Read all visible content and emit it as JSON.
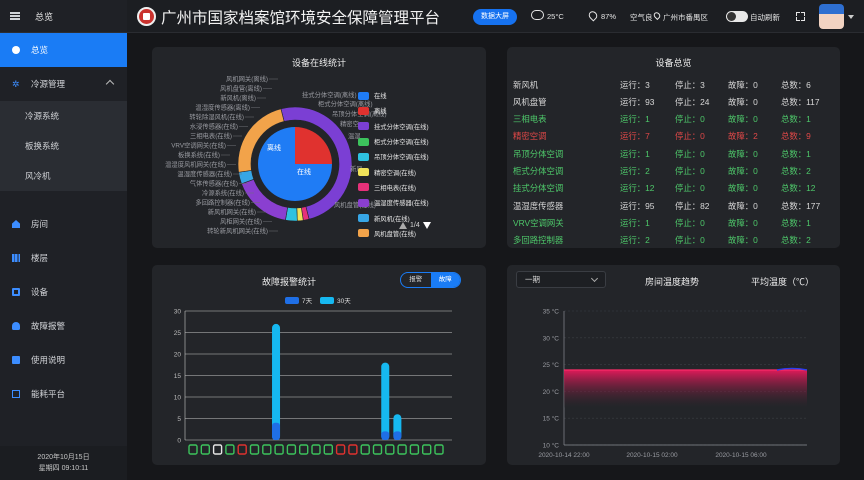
{
  "sidebar": {
    "header": "总览",
    "items": [
      {
        "label": "总览",
        "icon": "home-circle-icon"
      },
      {
        "label": "冷源管理",
        "icon": "snowflake-icon"
      },
      {
        "label": "房间",
        "icon": "house-icon"
      },
      {
        "label": "楼层",
        "icon": "building-icon"
      },
      {
        "label": "设备",
        "icon": "monitor-icon"
      },
      {
        "label": "故障报警",
        "icon": "bell-icon"
      },
      {
        "label": "使用说明",
        "icon": "doc-icon"
      },
      {
        "label": "能耗平台",
        "icon": "external-link-icon"
      }
    ],
    "subitems": [
      "冷源系统",
      "板换系统",
      "风冷机"
    ],
    "date": "2020年10月15日",
    "time": "星期四 09:10:11"
  },
  "topbar": {
    "title": "广州市国家档案馆环境安全保障管理平台",
    "big_screen": "数据大屏",
    "temperature": "25°C",
    "humidity": "87%",
    "air": "空气良",
    "location": "广州市番禺区",
    "auto_refresh": "自动刷新"
  },
  "online_panel": {
    "title": "设备在线统计",
    "legend": [
      {
        "label": "在线",
        "color": "#1f7cf5"
      },
      {
        "label": "离线",
        "color": "#e0322f"
      },
      {
        "label": "挂式分体空调(在线)",
        "color": "#7b3fd4"
      },
      {
        "label": "柜式分体空调(在线)",
        "color": "#3cc35c"
      },
      {
        "label": "吊顶分体空调(在线)",
        "color": "#2ec2e0"
      },
      {
        "label": "精密空调(在线)",
        "color": "#f0e25a"
      },
      {
        "label": "三相电表(在线)",
        "color": "#e6317a"
      },
      {
        "label": "温湿度传感器(在线)",
        "color": "#8a3fd0"
      },
      {
        "label": "新风机(在线)",
        "color": "#37a6e6"
      },
      {
        "label": "风机盘管(在线)",
        "color": "#f2a34a"
      }
    ],
    "pie_labels": {
      "inner_offline": "离线",
      "inner_online": "在线"
    },
    "left_labels": [
      "风机网关(离线)",
      "风机盘管(离线)",
      "新风机(离线)",
      "温湿度传感器(离线)",
      "转轮除湿风机(在线)",
      "水浸传感器(在线)",
      "三相电表(在线)",
      "VRV空调网关(在线)",
      "板换系统(在线)",
      "温湿度风机网关(在线)",
      "温湿度传感器(在线)",
      "气体传感器(在线)",
      "冷源系统(在线)",
      "多回路控制器(在线)",
      "新风机网关(在线)",
      "风柜网关(在线)",
      "转轮新风机网关(在线)"
    ],
    "right_labels": [
      "挂式分体空调(离线)",
      "柜式分体空调(离线)",
      "吊顶分体空调(离线)",
      "精密空",
      "温湿",
      "新风",
      "风机盘管(在线)"
    ],
    "pager": "1/4"
  },
  "overview_panel": {
    "title": "设备总览",
    "labels": {
      "run": "运行：",
      "stop": "停止：",
      "fault": "故障：",
      "total": "总数："
    },
    "rows": [
      {
        "name": "新风机",
        "run": "3",
        "stop": "3",
        "fault": "0",
        "total": "6",
        "color": "#d8d8d8"
      },
      {
        "name": "风机盘管",
        "run": "93",
        "stop": "24",
        "fault": "0",
        "total": "117",
        "color": "#d8d8d8"
      },
      {
        "name": "三相电表",
        "run": "1",
        "stop": "0",
        "fault": "0",
        "total": "1",
        "color": "#4ec86a"
      },
      {
        "name": "精密空调",
        "run": "7",
        "stop": "0",
        "fault": "2",
        "total": "9",
        "color": "#e04848"
      },
      {
        "name": "吊顶分体空调",
        "run": "1",
        "stop": "0",
        "fault": "0",
        "total": "1",
        "color": "#4ec86a"
      },
      {
        "name": "柜式分体空调",
        "run": "2",
        "stop": "0",
        "fault": "0",
        "total": "2",
        "color": "#4ec86a"
      },
      {
        "name": "挂式分体空调",
        "run": "12",
        "stop": "0",
        "fault": "0",
        "total": "12",
        "color": "#4ec86a"
      },
      {
        "name": "温湿度传感器",
        "run": "95",
        "stop": "82",
        "fault": "0",
        "total": "177",
        "color": "#d8d8d8"
      },
      {
        "name": "VRV空调网关",
        "run": "1",
        "stop": "0",
        "fault": "0",
        "total": "1",
        "color": "#4ec86a"
      },
      {
        "name": "多回路控制器",
        "run": "2",
        "stop": "0",
        "fault": "0",
        "total": "2",
        "color": "#4ec86a"
      }
    ]
  },
  "fault_panel": {
    "title": "故障报警统计",
    "tab_alarm": "报警",
    "tab_fault": "故障"
  },
  "temp_panel": {
    "select": "一期",
    "title": "房间温度趋势",
    "subtitle": "平均温度（℃）"
  },
  "chart_data": [
    {
      "type": "pie",
      "title": "设备在线统计",
      "inner": [
        {
          "name": "在线",
          "value": 75
        },
        {
          "name": "离线",
          "value": 25
        }
      ],
      "outer_colors": [
        "#7b3fd4",
        "#e6317a",
        "#f0e25a",
        "#2ec2e0",
        "#8a3fd0",
        "#37a6e6",
        "#f2a34a"
      ],
      "outer_values": [
        30,
        1,
        1,
        2,
        10,
        2,
        14
      ]
    },
    {
      "type": "bar",
      "title": "故障报警统计",
      "series": [
        {
          "name": "7天",
          "color": "#1f6fe6"
        },
        {
          "name": "30天",
          "color": "#16b8f0"
        }
      ],
      "ylim": [
        0,
        30
      ],
      "yticks": [
        0,
        5,
        10,
        15,
        20,
        25,
        30
      ],
      "bars": [
        {
          "slot": 7,
          "v7": 4,
          "v30": 27
        },
        {
          "slot": 16,
          "v7": 2,
          "v30": 18
        },
        {
          "slot": 17,
          "v7": 2,
          "v30": 6
        }
      ],
      "slots": 22
    },
    {
      "type": "area",
      "title": "房间温度趋势",
      "ylabel": "平均温度（℃）",
      "ylim": [
        10,
        35
      ],
      "yticks": [
        "10 °C",
        "15 °C",
        "20 °C",
        "25 °C",
        "30 °C",
        "35 °C"
      ],
      "xticks": [
        "2020-10-14 22:00",
        "2020-10-15 02:00",
        "2020-10-15 06:00"
      ],
      "series_value": 24
    }
  ]
}
